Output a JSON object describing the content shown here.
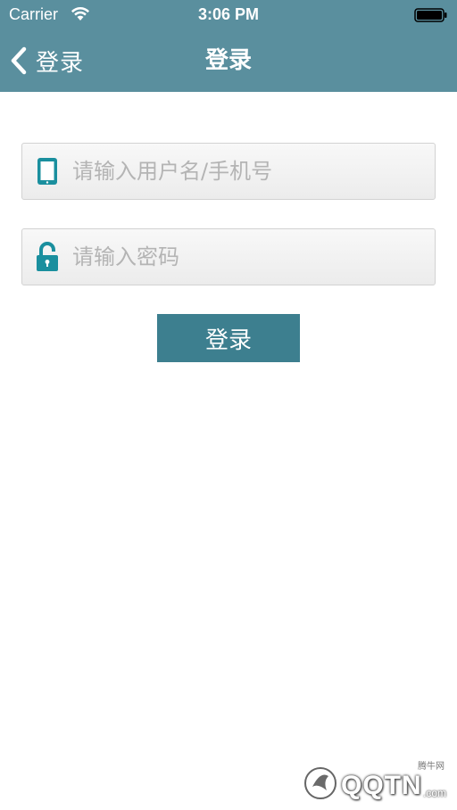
{
  "status_bar": {
    "carrier": "Carrier",
    "time": "3:06 PM",
    "wifi_icon": "wifi-icon",
    "battery_icon": "battery-icon"
  },
  "nav_bar": {
    "back_label": "登录",
    "title": "登录",
    "back_icon": "chevron-left-icon"
  },
  "form": {
    "username": {
      "value": "",
      "placeholder": "请输入用户名/手机号",
      "icon": "phone-icon"
    },
    "password": {
      "value": "",
      "placeholder": "请输入密码",
      "icon": "unlock-icon"
    },
    "submit_label": "登录"
  },
  "watermark": {
    "small": "腾牛网",
    "main": "QQTN",
    ".com": ".com"
  },
  "colors": {
    "header": "#5a8f9e",
    "button": "#3d7f8f",
    "icon_accent": "#1a8f9e",
    "background": "#ffffff"
  }
}
